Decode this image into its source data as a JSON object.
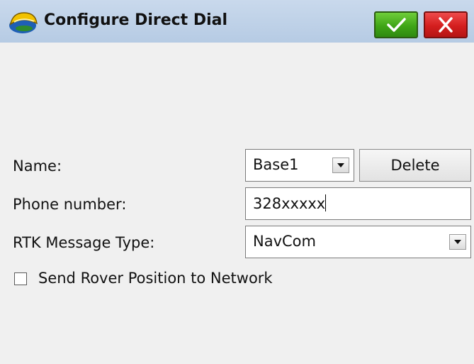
{
  "window": {
    "title": "Configure Direct Dial",
    "app_icon": "survey-helmet-icon",
    "ok_icon": "checkmark-icon",
    "close_icon": "close-x-icon"
  },
  "form": {
    "name": {
      "label": "Name:",
      "value": "Base1",
      "delete_label": "Delete"
    },
    "phone": {
      "label": "Phone number:",
      "value": "328xxxxx"
    },
    "rtk": {
      "label": "RTK Message Type:",
      "value": "NavCom"
    },
    "send_rover": {
      "label": "Send Rover Position to Network",
      "checked": false
    }
  },
  "colors": {
    "titlebar": "#b6cbe4",
    "ok": "#3fa516",
    "close": "#d41e1e",
    "background": "#f0f0f0"
  }
}
